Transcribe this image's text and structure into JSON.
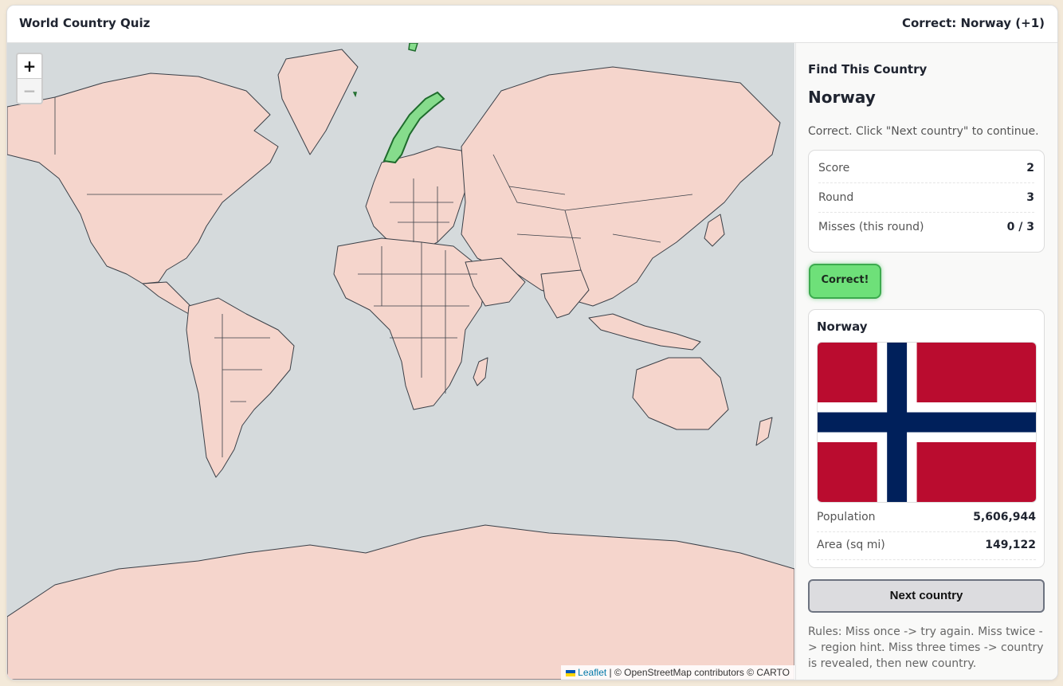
{
  "header": {
    "title": "World Country Quiz",
    "status": "Correct: Norway (+1)"
  },
  "map": {
    "zoom_in": "+",
    "zoom_out": "−",
    "attribution_link": "Leaflet",
    "attribution_text": "| © OpenStreetMap contributors © CARTO",
    "colors": {
      "ocean": "#d5dadc",
      "land": "#f5d5cc",
      "border": "#3a3f47",
      "highlight": "#86dc8c",
      "highlight_border": "#1e6b2c"
    }
  },
  "panel": {
    "find_label": "Find This Country",
    "country": "Norway",
    "message": "Correct. Click \"Next country\" to continue.",
    "stats": [
      {
        "label": "Score",
        "value": "2"
      },
      {
        "label": "Round",
        "value": "3"
      },
      {
        "label": "Misses (this round)",
        "value": "0 / 3"
      }
    ],
    "feedback_button": "Correct!",
    "info": {
      "name": "Norway",
      "population_label": "Population",
      "population_value": "5,606,944",
      "area_label": "Area (sq mi)",
      "area_value": "149,122",
      "flag_colors": {
        "red": "#ba0c2f",
        "white": "#ffffff",
        "blue": "#00205b"
      }
    },
    "next_button": "Next country",
    "rules": "Rules: Miss once -> try again. Miss twice -> region hint. Miss three times -> country is revealed, then new country."
  }
}
